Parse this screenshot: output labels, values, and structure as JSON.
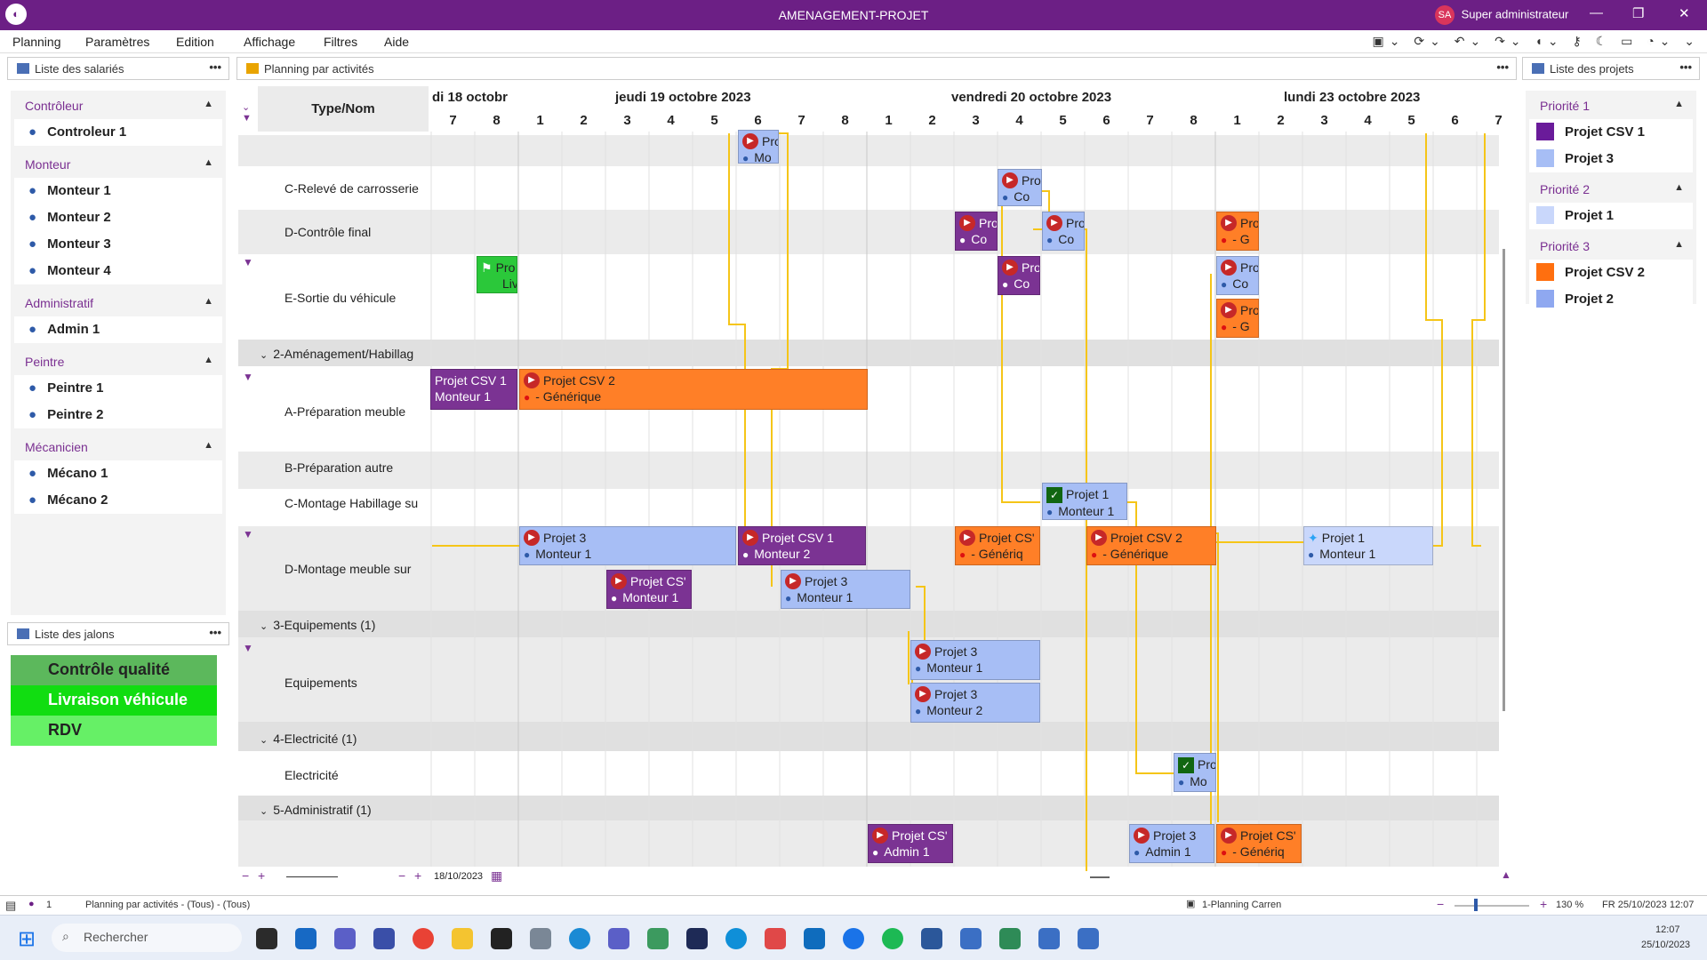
{
  "window": {
    "title": "AMENAGEMENT-PROJET",
    "user_initials": "SA",
    "user_name": "Super administrateur"
  },
  "menu": [
    "Planning",
    "Paramètres",
    "Edition",
    "Affichage",
    "Filtres",
    "Aide"
  ],
  "panels": {
    "employees_title": "Liste des salariés",
    "planning_title": "Planning par activités",
    "milestones_title": "Liste des jalons",
    "projects_title": "Liste des projets",
    "more": "•••"
  },
  "employee_groups": [
    {
      "name": "Contrôleur",
      "members": [
        "Controleur 1"
      ]
    },
    {
      "name": "Monteur",
      "members": [
        "Monteur 1",
        "Monteur 2",
        "Monteur 3",
        "Monteur 4"
      ]
    },
    {
      "name": "Administratif",
      "members": [
        "Admin 1"
      ]
    },
    {
      "name": "Peintre",
      "members": [
        "Peintre 1",
        "Peintre 2"
      ]
    },
    {
      "name": "Mécanicien",
      "members": [
        "Mécano 1",
        "Mécano 2"
      ]
    }
  ],
  "milestones": [
    {
      "label": "Contrôle qualité",
      "color": "#5cb85c"
    },
    {
      "label": "Livraison véhicule",
      "color": "#11dd11"
    },
    {
      "label": "RDV",
      "color": "#66f066"
    }
  ],
  "project_groups": [
    {
      "name": "Priorité 1",
      "projects": [
        {
          "label": "Projet CSV 1",
          "color": "#6a1b9a"
        },
        {
          "label": "Projet 3",
          "color": "#a7bef5"
        }
      ]
    },
    {
      "name": "Priorité 2",
      "projects": [
        {
          "label": "Projet 1",
          "color": "#c9d7fb"
        }
      ]
    },
    {
      "name": "Priorité 3",
      "projects": [
        {
          "label": "Projet CSV 2",
          "color": "#ff6f0f"
        },
        {
          "label": "Projet 2",
          "color": "#8fa8f0"
        }
      ]
    }
  ],
  "gantt": {
    "type_header": "Type/Nom",
    "days": [
      "di 18 octobr",
      "jeudi 19 octobre 2023",
      "vendredi 20 octobre 2023",
      "lundi 23 octobre 2023"
    ],
    "hours": [
      "7",
      "8",
      "1",
      "2",
      "3",
      "4",
      "5",
      "6",
      "7",
      "8",
      "1",
      "2",
      "3",
      "4",
      "5",
      "6",
      "7",
      "8",
      "1",
      "2",
      "3",
      "4",
      "5",
      "6",
      "7"
    ],
    "rows": [
      "C-Relevé de carrosserie",
      "D-Contrôle final",
      "E-Sortie du véhicule",
      "2-Aménagement/Habillag",
      "A-Préparation meuble",
      "B-Préparation autre",
      "C-Montage Habillage su",
      "D-Montage meuble sur",
      "3-Equipements (1)",
      "Equipements",
      "4-Electricité (1)",
      "Electricité",
      "5-Administratif (1)"
    ],
    "bars": [
      {
        "l1": "Pro",
        "l2": "Mo"
      },
      {
        "l1": "Pro",
        "l2": "Co"
      },
      {
        "l1": "Pro",
        "l2": "Co"
      },
      {
        "l1": "Pro",
        "l2": "Co"
      },
      {
        "l1": "Pro",
        "l2": "- G"
      },
      {
        "l1": "Pro",
        "l2": "Liv"
      },
      {
        "l1": "Pro",
        "l2": "Co"
      },
      {
        "l1": "Pro",
        "l2": "Co"
      },
      {
        "l1": "Pro",
        "l2": "- G"
      },
      {
        "l1": "Projet CSV 1",
        "l2": "Monteur 1"
      },
      {
        "l1": "Projet CSV 2",
        "l2": "- Générique"
      },
      {
        "l1": "Projet 1",
        "l2": "Monteur 1"
      },
      {
        "l1": "Projet 3",
        "l2": "Monteur 1"
      },
      {
        "l1": "Projet CSV 1",
        "l2": "Monteur 2"
      },
      {
        "l1": "Projet CS'",
        "l2": "- Génériq"
      },
      {
        "l1": "Projet CSV 2",
        "l2": "- Générique"
      },
      {
        "l1": "Projet 1",
        "l2": "Monteur 1"
      },
      {
        "l1": "Projet CS'",
        "l2": "Monteur 1"
      },
      {
        "l1": "Projet 3",
        "l2": "Monteur 1"
      },
      {
        "l1": "Projet 3",
        "l2": "Monteur 1"
      },
      {
        "l1": "Projet 3",
        "l2": "Monteur 2"
      },
      {
        "l1": "Pro",
        "l2": "Mo"
      },
      {
        "l1": "Projet CS'",
        "l2": "Admin 1"
      },
      {
        "l1": "Projet 3",
        "l2": "Admin 1"
      },
      {
        "l1": "Projet CS'",
        "l2": "- Génériq"
      }
    ],
    "footer_date": "18/10/2023"
  },
  "status": {
    "count": "1",
    "view": "Planning par activités - (Tous) - (Tous)",
    "planning": "1-Planning Carren",
    "zoom": "130 %",
    "lang_date": "FR 25/10/2023 12:07"
  },
  "taskbar": {
    "search": "Rechercher",
    "time": "12:07",
    "date": "25/10/2023"
  }
}
